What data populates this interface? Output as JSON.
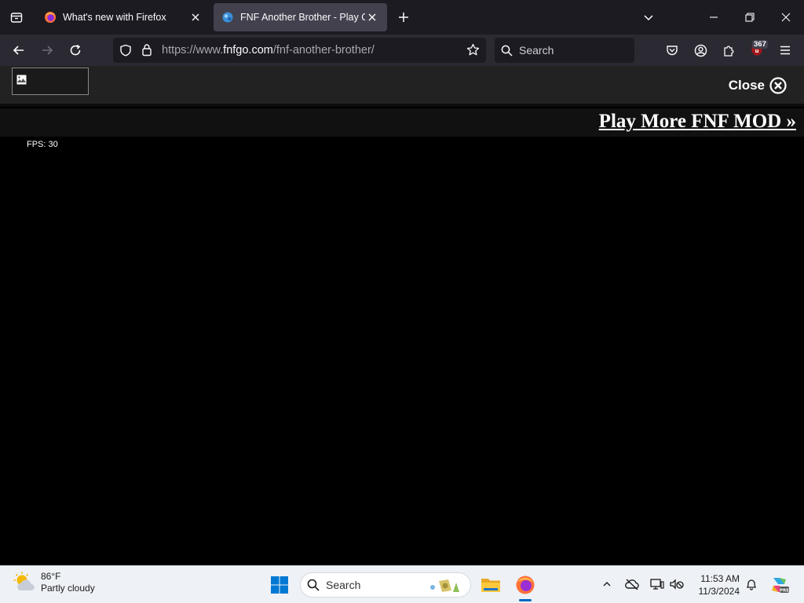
{
  "browser": {
    "tabs": [
      {
        "title": "What's new with Firefox",
        "active": false
      },
      {
        "title": "FNF Another Brother - Play Onl",
        "active": true
      }
    ],
    "url": {
      "prefix": "https://www.",
      "host": "fnfgo.com",
      "path": "/fnf-another-brother/"
    },
    "search_placeholder": "Search",
    "extension_badge": "367",
    "colors": {
      "tabstrip": "#1c1b22",
      "navbar": "#2b2a33",
      "active_tab": "#42414d"
    }
  },
  "page": {
    "close_label": "Close",
    "more_link": "Play More FNF MOD »",
    "fps_counter": "FPS: 30"
  },
  "taskbar": {
    "weather": {
      "temp": "86°F",
      "condition": "Partly cloudy"
    },
    "search_placeholder": "Search",
    "time": "11:53 AM",
    "date": "11/3/2024",
    "icons": [
      "weather-icon",
      "start-icon",
      "search-icon",
      "file-explorer-icon",
      "firefox-icon",
      "chevron-up-icon",
      "cloud-offline-icon",
      "display-icon",
      "network-volume-icon",
      "bell-icon",
      "copilot-icon"
    ]
  }
}
